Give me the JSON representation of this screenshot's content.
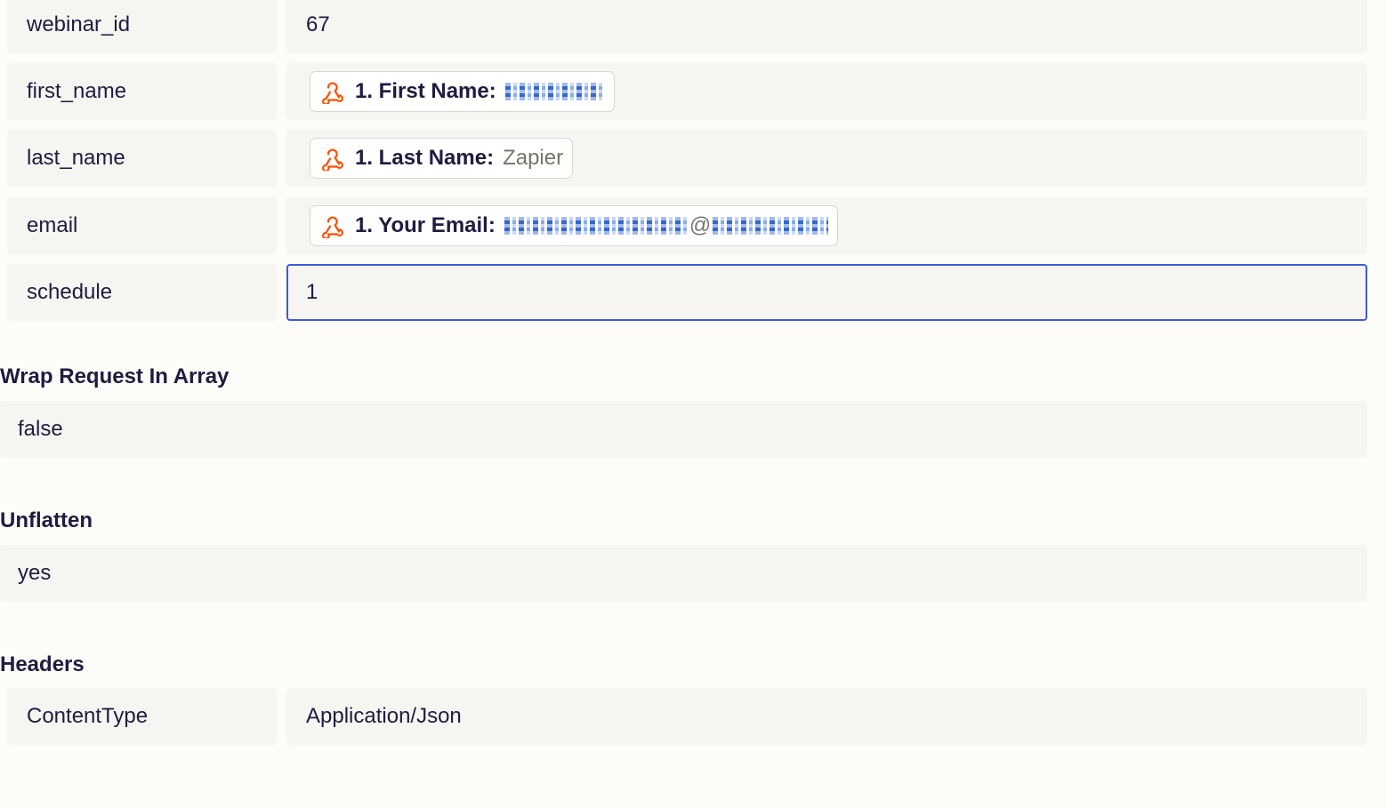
{
  "data_fields": [
    {
      "key": "webinar_id",
      "value": "67"
    },
    {
      "key": "first_name",
      "pill": {
        "label": "1. First Name:",
        "value": "",
        "redacted": true
      }
    },
    {
      "key": "last_name",
      "pill": {
        "label": "1. Last Name:",
        "value": "Zapier",
        "redacted": false
      }
    },
    {
      "key": "email",
      "pill": {
        "label": "1. Your Email:",
        "value": "@",
        "redacted": true
      }
    },
    {
      "key": "schedule",
      "value": "1"
    }
  ],
  "wrap_request": {
    "title": "Wrap Request In Array",
    "value": "false"
  },
  "unflatten": {
    "title": "Unflatten",
    "value": "yes"
  },
  "headers": {
    "title": "Headers",
    "rows": [
      {
        "key": "ContentType",
        "value": "Application/Json"
      }
    ]
  },
  "icons": {
    "pill_icon": "webhook-icon"
  },
  "colors": {
    "webhook_icon": "#ff4f00",
    "focus_border": "#3f5bd6",
    "redaction": "#1f56c7"
  }
}
